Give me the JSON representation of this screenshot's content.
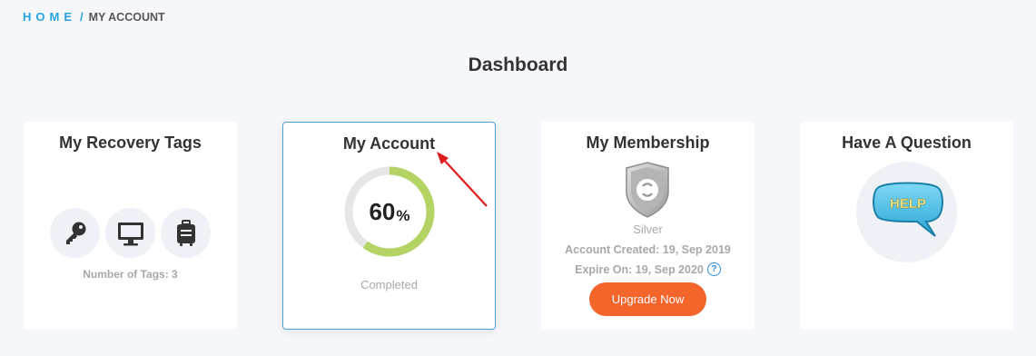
{
  "breadcrumb": {
    "home": "HOME",
    "separator": "/",
    "current": "MY ACCOUNT"
  },
  "page": {
    "title": "Dashboard"
  },
  "cards": {
    "recovery_tags": {
      "title": "My Recovery Tags",
      "icons": [
        "key-icon",
        "monitor-icon",
        "luggage-icon"
      ],
      "count_text": "Number of Tags: 3"
    },
    "account": {
      "title": "My Account",
      "progress_value": "60",
      "progress_unit": "%",
      "progress_fraction": 0.6,
      "status": "Completed"
    },
    "membership": {
      "title": "My Membership",
      "badge_icon": "silver-shield-icon",
      "level": "Silver",
      "created": "Account Created: 19, Sep 2019",
      "expire": "Expire On: 19, Sep 2020",
      "help_icon": "question-circle-icon",
      "help_glyph": "?",
      "upgrade_label": "Upgrade Now"
    },
    "question": {
      "title": "Have A Question",
      "help_bubble_text": "HELP"
    }
  },
  "colors": {
    "accent": "#29a3e0",
    "progress": "#b3d465",
    "progress_track": "#e6e6e6",
    "upgrade": "#f4652b",
    "active_border": "#4a9fd8",
    "annotation_arrow": "#e01b1b"
  }
}
